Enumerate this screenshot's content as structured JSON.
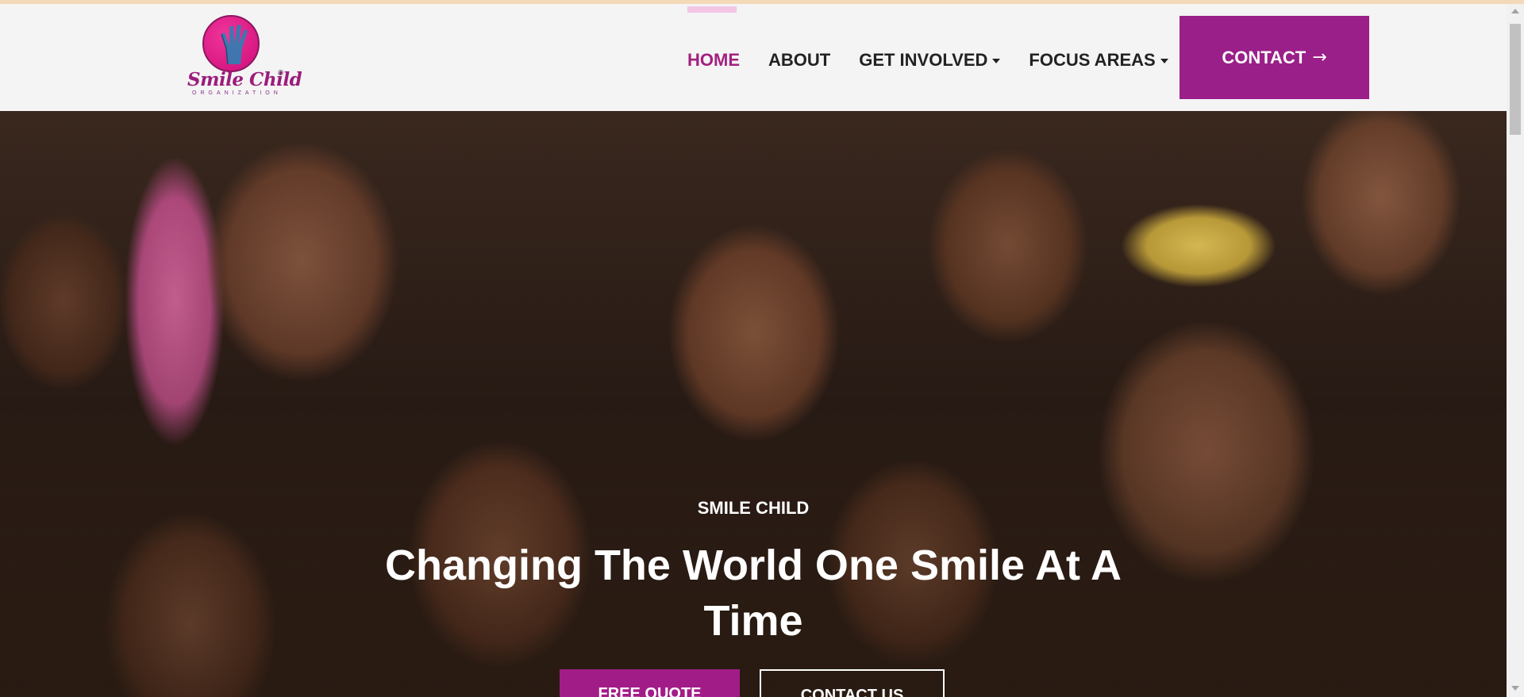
{
  "logo": {
    "name": "Smile Child",
    "subtitle": "ORGANIZATION",
    "copyright": "©"
  },
  "nav": {
    "items": [
      {
        "label": "HOME",
        "active": true,
        "dropdown": false
      },
      {
        "label": "ABOUT",
        "active": false,
        "dropdown": false
      },
      {
        "label": "GET INVOLVED",
        "active": false,
        "dropdown": true
      },
      {
        "label": "FOCUS AREAS",
        "active": false,
        "dropdown": true
      }
    ],
    "contact_label": "CONTACT",
    "contact_icon": "arrow-right-icon"
  },
  "hero": {
    "eyebrow": "SMILE CHILD",
    "title": "Changing The World One Smile At A Time",
    "primary_button": "FREE QUOTE",
    "secondary_button": "CONTACT US"
  },
  "colors": {
    "brand": "#9a1f89",
    "active_nav": "#a3207f",
    "logo_pink": "#e0197f",
    "header_bg": "#f4f4f4"
  }
}
